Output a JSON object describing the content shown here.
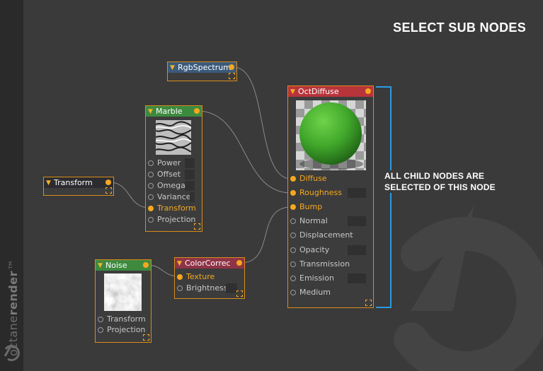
{
  "header": {
    "title": "SELECT SUB NODES"
  },
  "annotation": {
    "line1": "ALL CHILD NODES ARE",
    "line2": "SELECTED OF THIS NODE",
    "color": "#2a9be0"
  },
  "brand": {
    "text_light": "octane",
    "text_bold": "render",
    "trademark": "™"
  },
  "colors": {
    "accent": "#f5a81f",
    "node_border": "#d98c1a",
    "background": "#3a3a3a"
  },
  "nodes": {
    "rgbspectrum": {
      "title": "RgbSpectrum"
    },
    "marble": {
      "title": "Marble",
      "pins": [
        "Power",
        "Offset",
        "Omega",
        "Variance",
        "Transform",
        "Projection"
      ]
    },
    "transform": {
      "title": "Transform"
    },
    "octdiffuse": {
      "title": "OctDiffuse",
      "pins": [
        "Diffuse",
        "Roughness",
        "Bump",
        "Normal",
        "Displacement",
        "Opacity",
        "Transmission",
        "Emission",
        "Medium"
      ]
    },
    "noise": {
      "title": "Noise",
      "pins": [
        "Transform",
        "Projection"
      ]
    },
    "colorcorrect": {
      "title": "ColorCorrec",
      "pins": [
        "Texture",
        "Brightness"
      ]
    }
  }
}
